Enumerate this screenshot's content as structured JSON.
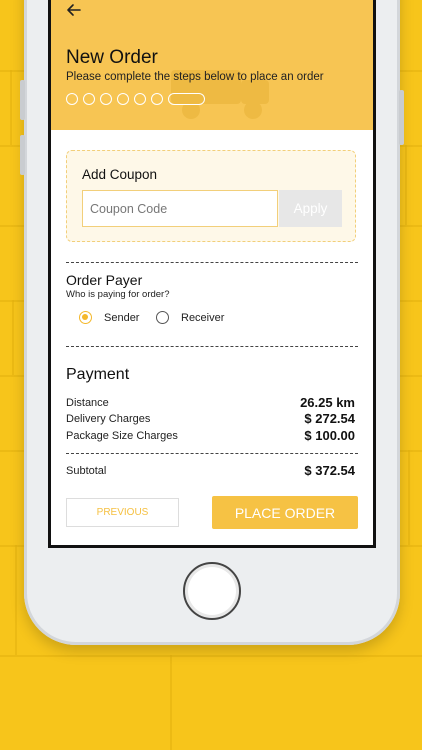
{
  "header": {
    "back_icon": "back-arrow-icon",
    "title": "New Order",
    "subtitle": "Please complete the steps below to place an order",
    "step_count": 6,
    "color": "#f7c553"
  },
  "coupon": {
    "title": "Add Coupon",
    "placeholder": "Coupon Code",
    "value": "",
    "apply_label": "Apply"
  },
  "payer": {
    "title": "Order Payer",
    "subtitle": "Who is paying for order?",
    "options": [
      {
        "label": "Sender",
        "selected": true
      },
      {
        "label": "Receiver",
        "selected": false
      }
    ]
  },
  "payment": {
    "title": "Payment",
    "lines": [
      {
        "label": "Distance",
        "value": "26.25 km"
      },
      {
        "label": "Delivery Charges",
        "value": "$ 272.54"
      },
      {
        "label": "Package Size Charges",
        "value": "$ 100.00"
      }
    ],
    "subtotal": {
      "label": "Subtotal",
      "value": "$ 372.54"
    }
  },
  "actions": {
    "previous_label": "PREVIOUS",
    "place_order_label": "PLACE ORDER"
  },
  "colors": {
    "accent": "#f6c244",
    "background": "#f7c51b"
  }
}
